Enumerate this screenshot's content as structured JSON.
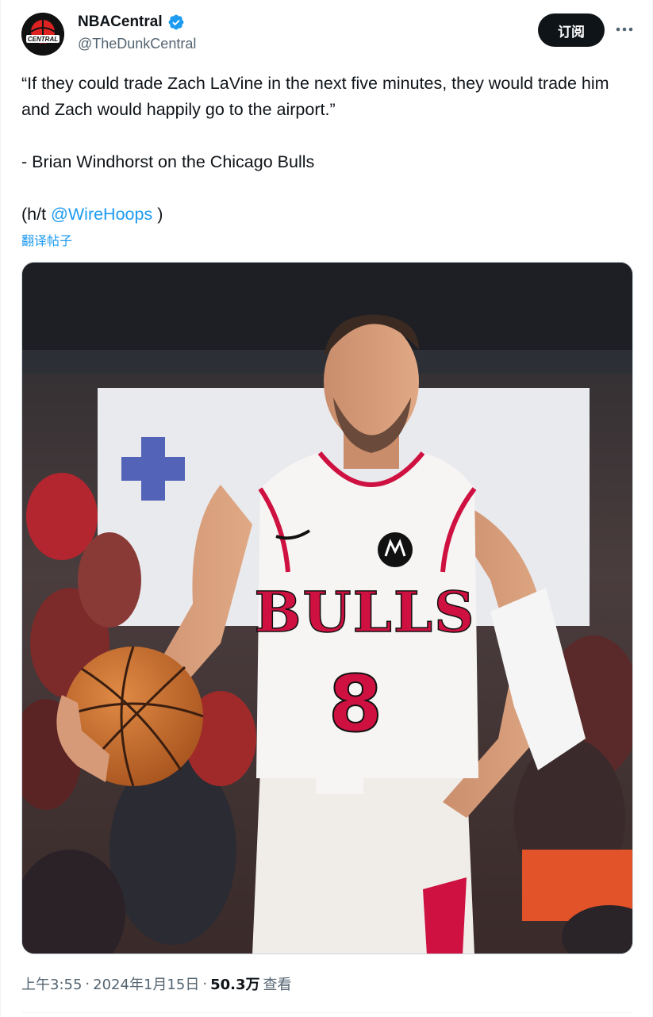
{
  "author": {
    "name": "NBACentral",
    "handle": "@TheDunkCentral",
    "avatar_text": "CENTRAL",
    "verified": true
  },
  "actions": {
    "subscribe_label": "订阅",
    "more_icon": "more-horizontal-icon"
  },
  "tweet": {
    "line1": "“If they could trade Zach LaVine in the next five minutes, they would trade him and Zach would happily go to the airport.”",
    "line2": "- Brian Windhorst on the Chicago Bulls",
    "hat_tip_prefix": "(h/t ",
    "hat_tip_mention": "@WireHoops",
    "hat_tip_suffix": " )",
    "translate_label": "翻译帖子"
  },
  "media": {
    "jersey_team": "BULLS",
    "jersey_number": "8"
  },
  "meta": {
    "time": "上午3:55",
    "separator": "·",
    "date": "2024年1月15日",
    "views_count": "50.3万",
    "views_label": "查看"
  },
  "colors": {
    "accent": "#1d9bf0",
    "text_primary": "#0f1419",
    "text_secondary": "#536471",
    "bulls_red": "#ce1141"
  }
}
